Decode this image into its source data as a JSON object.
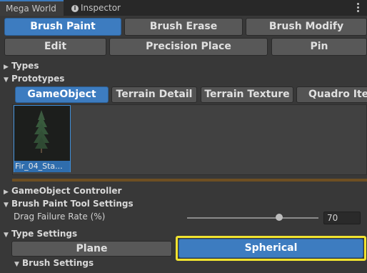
{
  "tabs": [
    {
      "label": "Mega World"
    },
    {
      "label": "Inspector",
      "icon": "info-icon"
    }
  ],
  "toolbar": {
    "row1": [
      "Brush Paint",
      "Brush Erase",
      "Brush Modify"
    ],
    "row2": [
      "Edit",
      "Precision Place",
      "Pin"
    ]
  },
  "foldouts": {
    "types": "Types",
    "prototypes": "Prototypes",
    "gameobject_controller": "GameObject Controller",
    "brush_tool_settings": "Brush Paint Tool Settings",
    "type_settings": "Type Settings",
    "brush_settings": "Brush Settings"
  },
  "prototype_tabs": [
    "GameObject",
    "Terrain Detail",
    "Terrain Texture",
    "Quadro Item"
  ],
  "prototype_item": {
    "label": "Fir_04_Sta...",
    "icon": "fir-tree-thumbnail"
  },
  "drag_failure": {
    "label": "Drag Failure Rate (%)",
    "value": "70",
    "slider_fraction": 0.7
  },
  "type_buttons": {
    "plane": "Plane",
    "spherical": "Spherical"
  },
  "colors": {
    "accent": "#3d7cc0",
    "selected_tab": "#46607c",
    "highlight": "#f0e330",
    "divider": "#6e4f22"
  }
}
